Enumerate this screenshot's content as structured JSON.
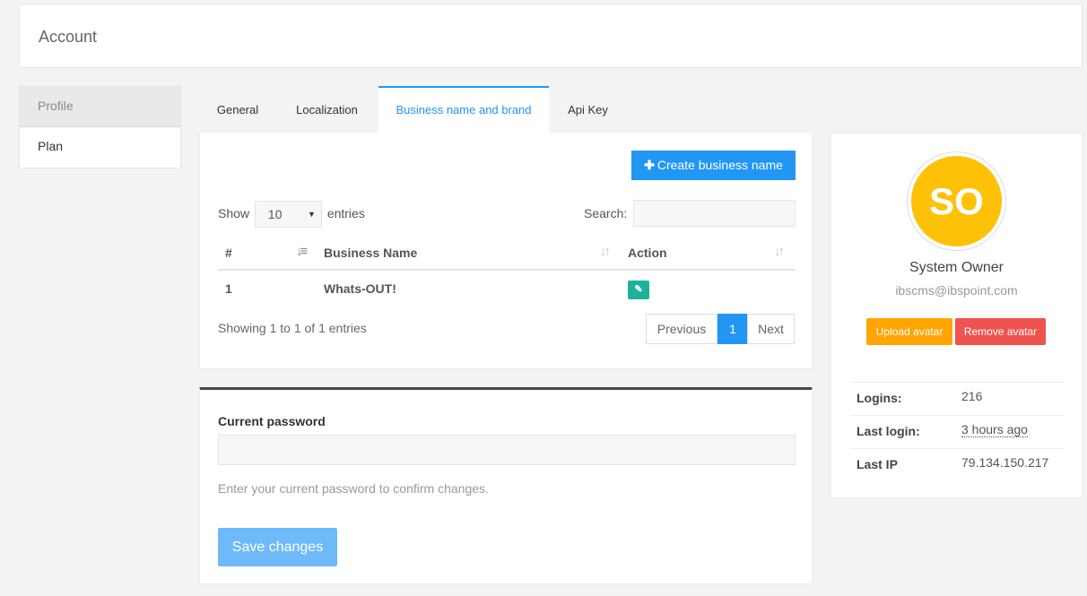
{
  "header": {
    "title": "Account"
  },
  "sidebar": {
    "items": [
      {
        "label": "Profile",
        "active": true
      },
      {
        "label": "Plan",
        "active": false
      }
    ]
  },
  "tabs": [
    {
      "label": "General"
    },
    {
      "label": "Localization"
    },
    {
      "label": "Business name and brand",
      "active": true
    },
    {
      "label": "Api Key"
    }
  ],
  "business": {
    "create_button": "Create business name",
    "create_icon": "plus-icon",
    "show_label": "Show",
    "entries_label": "entries",
    "page_length": "10",
    "search_label": "Search:",
    "columns": [
      "#",
      "Business Name",
      "Action"
    ],
    "rows": [
      {
        "num": "1",
        "name": "Whats-OUT!",
        "action_icon": "edit-icon"
      }
    ],
    "info": "Showing 1 to 1 of 1 entries",
    "pagination": {
      "previous": "Previous",
      "current": "1",
      "next": "Next"
    }
  },
  "password": {
    "label": "Current password",
    "help": "Enter your current password to confirm changes.",
    "save_button": "Save changes"
  },
  "profile": {
    "initials": "SO",
    "avatar_color": "#ffc107",
    "name": "System Owner",
    "email": "ibscms@ibspoint.com",
    "upload_button": "Upload avatar",
    "remove_button": "Remove avatar",
    "stats": [
      {
        "label": "Logins:",
        "value": "216"
      },
      {
        "label": "Last login:",
        "value": "3 hours ago"
      },
      {
        "label": "Last IP",
        "value": "79.134.150.217"
      }
    ]
  },
  "colors": {
    "primary": "#2196f3",
    "success": "#1fb29a",
    "warning": "#ffa500",
    "danger": "#ef5350"
  }
}
